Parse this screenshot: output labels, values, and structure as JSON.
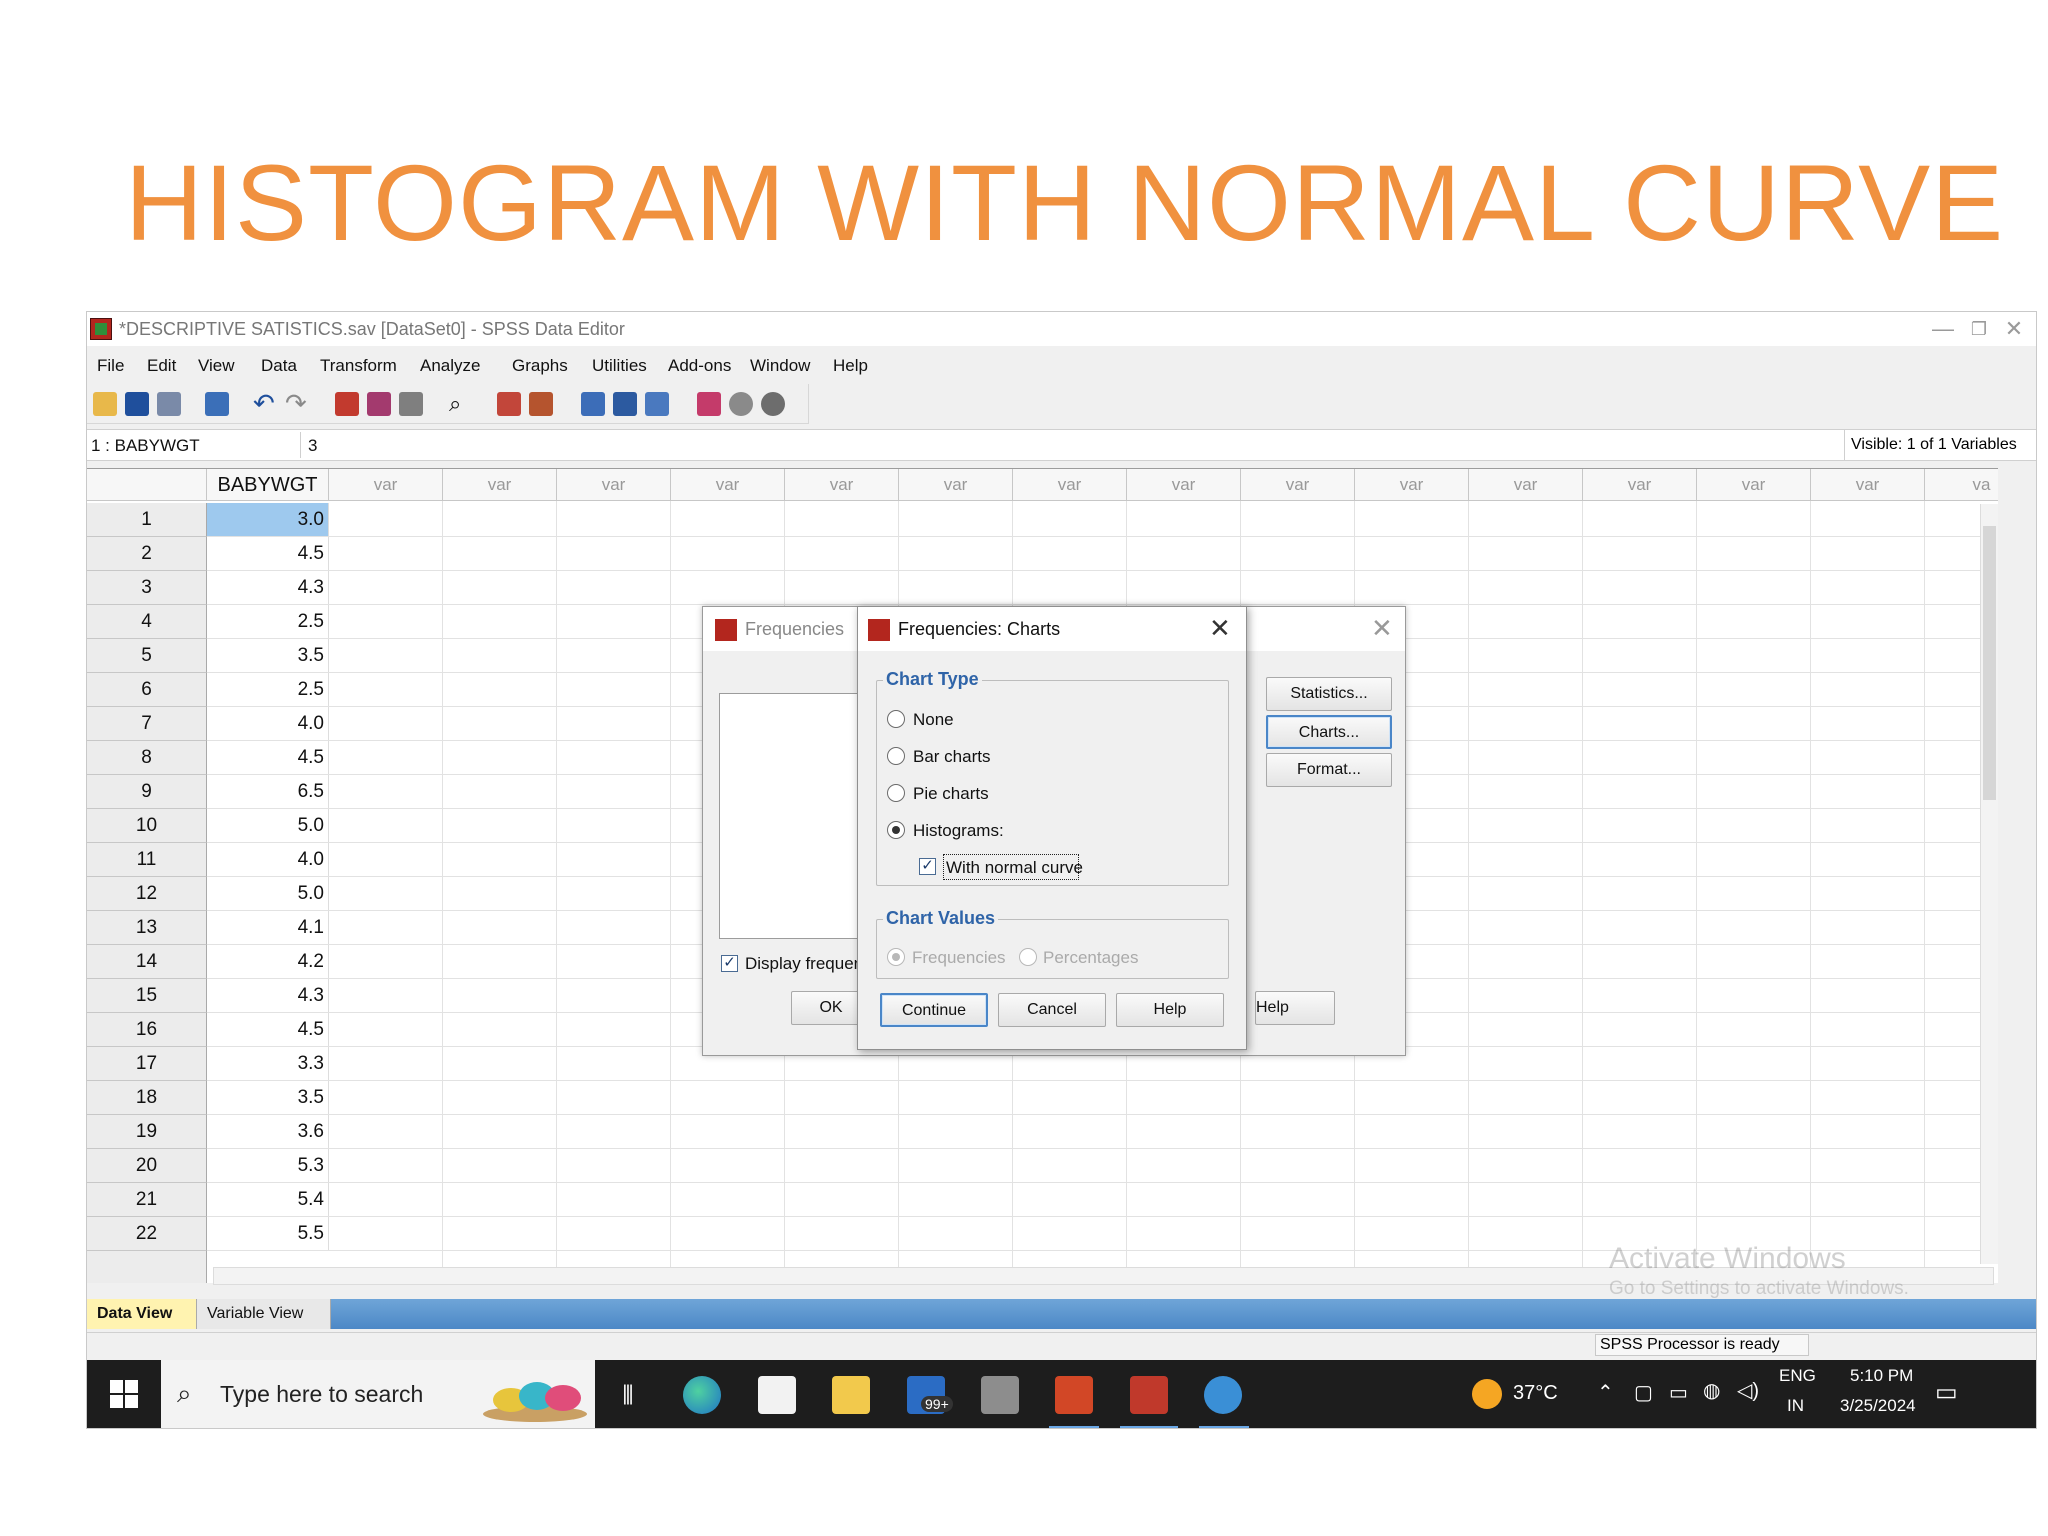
{
  "slide": {
    "title": "HISTOGRAM WITH NORMAL CURVE"
  },
  "window": {
    "title": "*DESCRIPTIVE SATISTICS.sav [DataSet0] - SPSS Data Editor",
    "minimize": "—",
    "restore": "❐",
    "close": "✕"
  },
  "menu": [
    "File",
    "Edit",
    "View",
    "Data",
    "Transform",
    "Analyze",
    "Graphs",
    "Utilities",
    "Add-ons",
    "Window",
    "Help"
  ],
  "toolbar_icons": [
    "open-icon",
    "save-icon",
    "print-icon",
    "dialog-recall-icon",
    "undo-icon",
    "redo-icon",
    "goto-case-icon",
    "goto-variable-icon",
    "variables-icon",
    "find-icon",
    "insert-cases-icon",
    "insert-variable-icon",
    "split-file-icon",
    "weight-cases-icon",
    "select-cases-icon",
    "value-labels-icon",
    "use-sets-icon",
    "show-all-icon"
  ],
  "cellbar": {
    "ref": "1 : BABYWGT",
    "value": "3",
    "visible": "Visible: 1 of 1 Variables"
  },
  "grid": {
    "main_column": "BABYWGT",
    "var_label": "var",
    "truncated_var_label": "va",
    "rows": [
      {
        "n": "1",
        "v": "3.0"
      },
      {
        "n": "2",
        "v": "4.5"
      },
      {
        "n": "3",
        "v": "4.3"
      },
      {
        "n": "4",
        "v": "2.5"
      },
      {
        "n": "5",
        "v": "3.5"
      },
      {
        "n": "6",
        "v": "2.5"
      },
      {
        "n": "7",
        "v": "4.0"
      },
      {
        "n": "8",
        "v": "4.5"
      },
      {
        "n": "9",
        "v": "6.5"
      },
      {
        "n": "10",
        "v": "5.0"
      },
      {
        "n": "11",
        "v": "4.0"
      },
      {
        "n": "12",
        "v": "5.0"
      },
      {
        "n": "13",
        "v": "4.1"
      },
      {
        "n": "14",
        "v": "4.2"
      },
      {
        "n": "15",
        "v": "4.3"
      },
      {
        "n": "16",
        "v": "4.5"
      },
      {
        "n": "17",
        "v": "3.3"
      },
      {
        "n": "18",
        "v": "3.5"
      },
      {
        "n": "19",
        "v": "3.6"
      },
      {
        "n": "20",
        "v": "5.3"
      },
      {
        "n": "21",
        "v": "5.4"
      },
      {
        "n": "22",
        "v": "5.5"
      }
    ]
  },
  "watermark": {
    "line1": "Activate Windows",
    "line2": "Go to Settings to activate Windows."
  },
  "tabs": {
    "data_view": "Data View",
    "variable_view": "Variable View"
  },
  "status": {
    "processor": "SPSS  Processor is ready"
  },
  "freq_dialog": {
    "title": "Frequencies",
    "statistics": "Statistics...",
    "charts": "Charts...",
    "format": "Format...",
    "display": "Display frequen",
    "ok": "OK",
    "help": "Help",
    "display_checked": true
  },
  "charts_dialog": {
    "title": "Frequencies: Charts",
    "chart_type_legend": "Chart Type",
    "none": "None",
    "bar": "Bar charts",
    "pie": "Pie charts",
    "histograms": "Histograms:",
    "normal_curve": "With normal curve",
    "selected_type": "Histograms",
    "normal_curve_checked": true,
    "chart_values_legend": "Chart Values",
    "frequencies": "Frequencies",
    "percentages": "Percentages",
    "continue": "Continue",
    "cancel": "Cancel",
    "help": "Help"
  },
  "taskbar": {
    "search_placeholder": "Type here to search",
    "mail_badge": "99+",
    "weather": "37°C",
    "lang1": "ENG",
    "lang2": "IN",
    "time": "5:10 PM",
    "date": "3/25/2024",
    "apps": [
      "task-view-icon",
      "edge-icon",
      "store-icon",
      "file-explorer-icon",
      "mail-icon",
      "photos-icon",
      "powerpoint-icon",
      "spss-icon",
      "paint-icon"
    ]
  },
  "colors": {
    "title_orange": "#F0913F",
    "selection_blue": "#9ec9ee",
    "legend_blue": "#2f64a8"
  }
}
